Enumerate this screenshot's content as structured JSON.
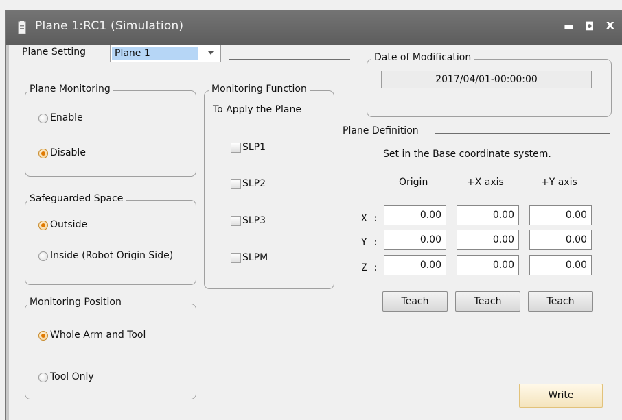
{
  "window": {
    "title": "Plane  1:RC1 (Simulation)",
    "controls": {
      "minimize": "▬",
      "maximize": "◘",
      "close": "x"
    }
  },
  "plane_setting": {
    "label": "Plane Setting",
    "selected": "Plane 1"
  },
  "plane_monitoring": {
    "title": "Plane Monitoring",
    "options": [
      "Enable",
      "Disable"
    ],
    "selected": "Disable"
  },
  "safeguarded_space": {
    "title": "Safeguarded Space",
    "options": [
      "Outside",
      "Inside (Robot Origin Side)"
    ],
    "selected": "Outside"
  },
  "monitoring_position": {
    "title": "Monitoring Position",
    "options": [
      "Whole Arm and Tool",
      "Tool Only"
    ],
    "selected": "Whole Arm and Tool"
  },
  "monitoring_function": {
    "title": "Monitoring Function",
    "subtitle": "To Apply the Plane",
    "items": [
      "SLP1",
      "SLP2",
      "SLP3",
      "SLPM"
    ]
  },
  "date_of_modification": {
    "title": "Date of Modification",
    "value": "2017/04/01-00:00:00"
  },
  "plane_definition": {
    "title": "Plane Definition",
    "note": "Set in the Base coordinate system.",
    "columns": [
      "Origin",
      "+X axis",
      "+Y axis"
    ],
    "rows": [
      {
        "label": "X :",
        "values": [
          "0.00",
          "0.00",
          "0.00"
        ]
      },
      {
        "label": "Y :",
        "values": [
          "0.00",
          "0.00",
          "0.00"
        ]
      },
      {
        "label": "Z :",
        "values": [
          "0.00",
          "0.00",
          "0.00"
        ]
      }
    ],
    "teach_label": "Teach"
  },
  "write_label": "Write"
}
